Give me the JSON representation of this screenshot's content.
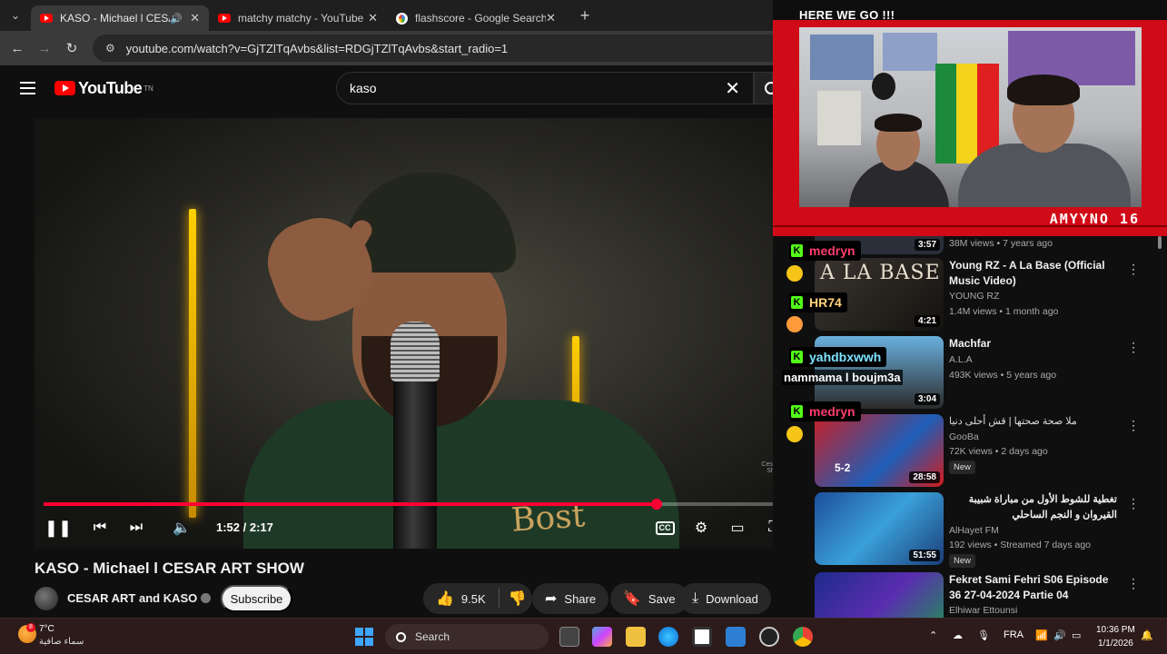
{
  "browser": {
    "tabs": [
      {
        "title": "KASO - Michael l CESAR AR",
        "active": true,
        "icon": "youtube-icon",
        "audio": true
      },
      {
        "title": "matchy matchy - YouTube",
        "active": false,
        "icon": "youtube-icon"
      },
      {
        "title": "flashscore - Google Search",
        "active": false,
        "icon": "google-icon"
      }
    ],
    "url": "youtube.com/watch?v=GjTZlTqAvbs&list=RDGjTZlTqAvbs&start_radio=1"
  },
  "youtube": {
    "logo_text": "YouTube",
    "logo_tm": "TN",
    "search_query": "kaso"
  },
  "player": {
    "time": "1:52 / 2:17",
    "progress_fraction": 0.816,
    "jacket_text": "Bost",
    "watermark": "Cesar Art Show"
  },
  "video": {
    "title": "KASO - Michael l CESAR ART SHOW",
    "channel": "CESAR ART and KASO",
    "subscribe_label": "Subscribe",
    "likes": "9.5K",
    "share_label": "Share",
    "save_label": "Save",
    "download_label": "Download"
  },
  "stream_overlay": {
    "heading": "HERE WE GO !!!",
    "streamer": "AMYYNO_16",
    "accent": "#d10a17"
  },
  "chat": [
    {
      "user": "medryn",
      "color": "#ff3d6b"
    },
    {
      "user": "HR74",
      "color": "#ffd27a"
    },
    {
      "user": "yahdbxwwh",
      "color": "#7fe3ff",
      "message": "nammama l boujm3a"
    },
    {
      "user": "medryn",
      "color": "#ff3d6b"
    }
  ],
  "sidebar": {
    "items": [
      {
        "title": "",
        "channel": "",
        "meta": "38M views • 7 years ago",
        "duration": "3:57"
      },
      {
        "title": "Young RZ - A La Base (Official Music Video)",
        "channel": "YOUNG RZ",
        "meta": "1.4M views • 1 month ago",
        "duration": "4:21",
        "thumb_text": "A LA BASE"
      },
      {
        "title": "Machfar",
        "channel": "A.L.A",
        "meta": "493K views • 5 years ago",
        "duration": "3:04"
      },
      {
        "title": "ملا صحة صحتها | قش أحلى دنيا",
        "channel": "GooBa",
        "meta": "72K views • 2 days ago",
        "duration": "28:58",
        "badge": "New",
        "thumb_text": "5-2"
      },
      {
        "title": "تغطية للشوط الأول من مباراة شبيبة القيروان و النجم الساحلي",
        "channel": "AlHayet FM",
        "meta": "192 views • Streamed 7 days ago",
        "duration": "51:55",
        "badge": "New"
      },
      {
        "title": "Fekret Sami Fehri S06 Episode 36 27-04-2024 Partie 04",
        "channel": "Elhiwar Ettounsi",
        "meta": "",
        "duration": ""
      }
    ]
  },
  "taskbar": {
    "temperature": "7°C",
    "weather_desc": "سماء صافية",
    "weather_badge": "8",
    "search_label": "Search",
    "lang": "FRA",
    "time": "10:36 PM",
    "date": "1/1/2026"
  }
}
